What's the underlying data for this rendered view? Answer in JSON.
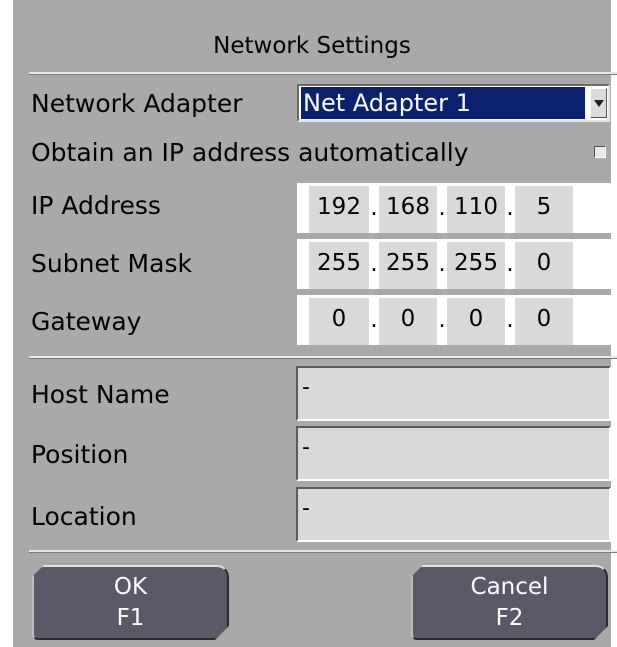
{
  "dialog": {
    "title": "Network Settings"
  },
  "network_adapter": {
    "label": "Network Adapter",
    "value": "Net Adapter 1"
  },
  "auto_ip": {
    "label": "Obtain an IP address automatically",
    "checked": false
  },
  "ip_address": {
    "label": "IP Address",
    "octets": [
      "192",
      "168",
      "110",
      "5"
    ]
  },
  "subnet_mask": {
    "label": "Subnet Mask",
    "octets": [
      "255",
      "255",
      "255",
      "0"
    ]
  },
  "gateway": {
    "label": "Gateway",
    "octets": [
      "0",
      "0",
      "0",
      "0"
    ]
  },
  "host_name": {
    "label": "Host Name",
    "value": "-"
  },
  "position": {
    "label": "Position",
    "value": "-"
  },
  "location": {
    "label": "Location",
    "value": "-"
  },
  "buttons": {
    "ok_label": "OK",
    "ok_key": "F1",
    "cancel_label": "Cancel",
    "cancel_key": "F2"
  },
  "ip_separator": ".",
  "colors": {
    "panel": "#a9a9a9",
    "selection": "#0a2170",
    "field": "#d9d9d9",
    "button": "#5a5968"
  },
  "icons": {
    "dropdown": "chevron-down-icon",
    "checkbox": "checkbox-unchecked-icon"
  }
}
